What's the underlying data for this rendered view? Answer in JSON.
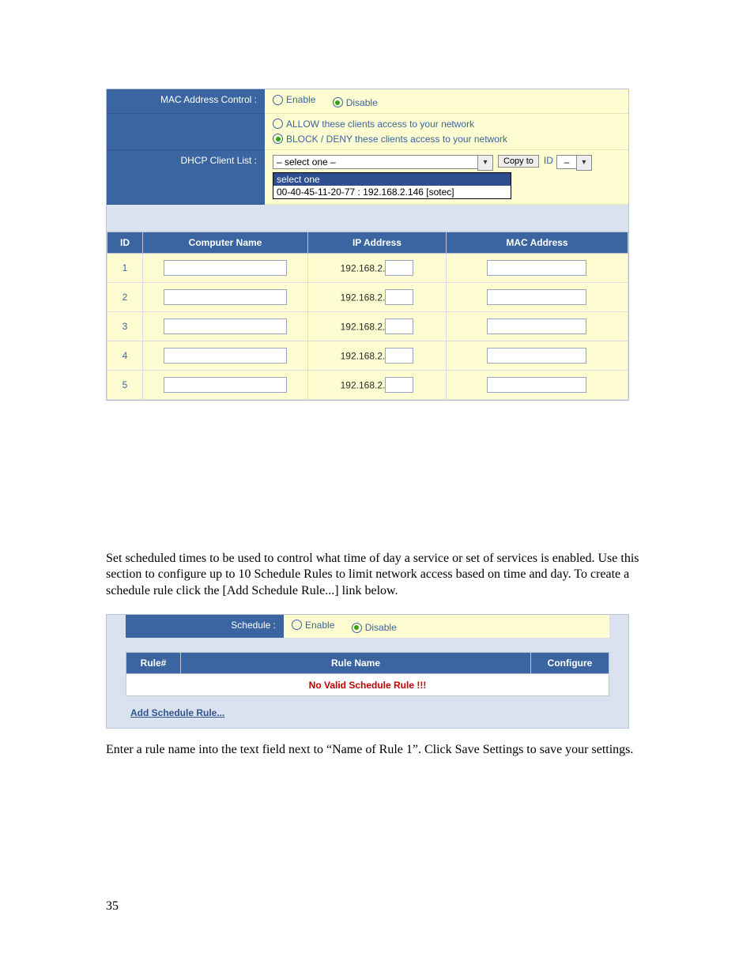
{
  "mac_control": {
    "label": "MAC Address Control :",
    "enable": "Enable",
    "disable": "Disable",
    "selected": "disable",
    "allow_text": "ALLOW these clients access to your network",
    "block_text": "BLOCK / DENY these clients access to your network",
    "policy_selected": "block"
  },
  "dhcp": {
    "label": "DHCP Client List :",
    "selected_text": "– select one –",
    "copy_label": "Copy to",
    "id_label": "ID",
    "id_value": "–",
    "list_options": {
      "highlight": "select one",
      "item": "00-40-45-11-20-77 : 192.168.2.146 [sotec]"
    }
  },
  "client_table": {
    "headers": {
      "id": "ID",
      "name": "Computer Name",
      "ip": "IP Address",
      "mac": "MAC Address"
    },
    "ip_prefix": "192.168.2.",
    "rows": [
      {
        "id": "1"
      },
      {
        "id": "2"
      },
      {
        "id": "3"
      },
      {
        "id": "4"
      },
      {
        "id": "5"
      }
    ]
  },
  "paragraph1": "Set scheduled times to be used to control what time of day a service or set of services is enabled. Use this section to configure up to 10 Schedule Rules to limit network access based on time and day. To create a schedule rule click the [Add Schedule Rule...] link below.",
  "schedule": {
    "label": "Schedule :",
    "enable": "Enable",
    "disable": "Disable",
    "selected": "disable",
    "headers": {
      "rule_no": "Rule#",
      "rule_name": "Rule Name",
      "configure": "Configure"
    },
    "no_rule_text": "No Valid Schedule Rule !!!",
    "add_link": "Add Schedule Rule..."
  },
  "paragraph2": "Enter a rule name into the text field next to “Name of Rule 1”. Click Save Settings to save your settings.",
  "page_number": "35"
}
